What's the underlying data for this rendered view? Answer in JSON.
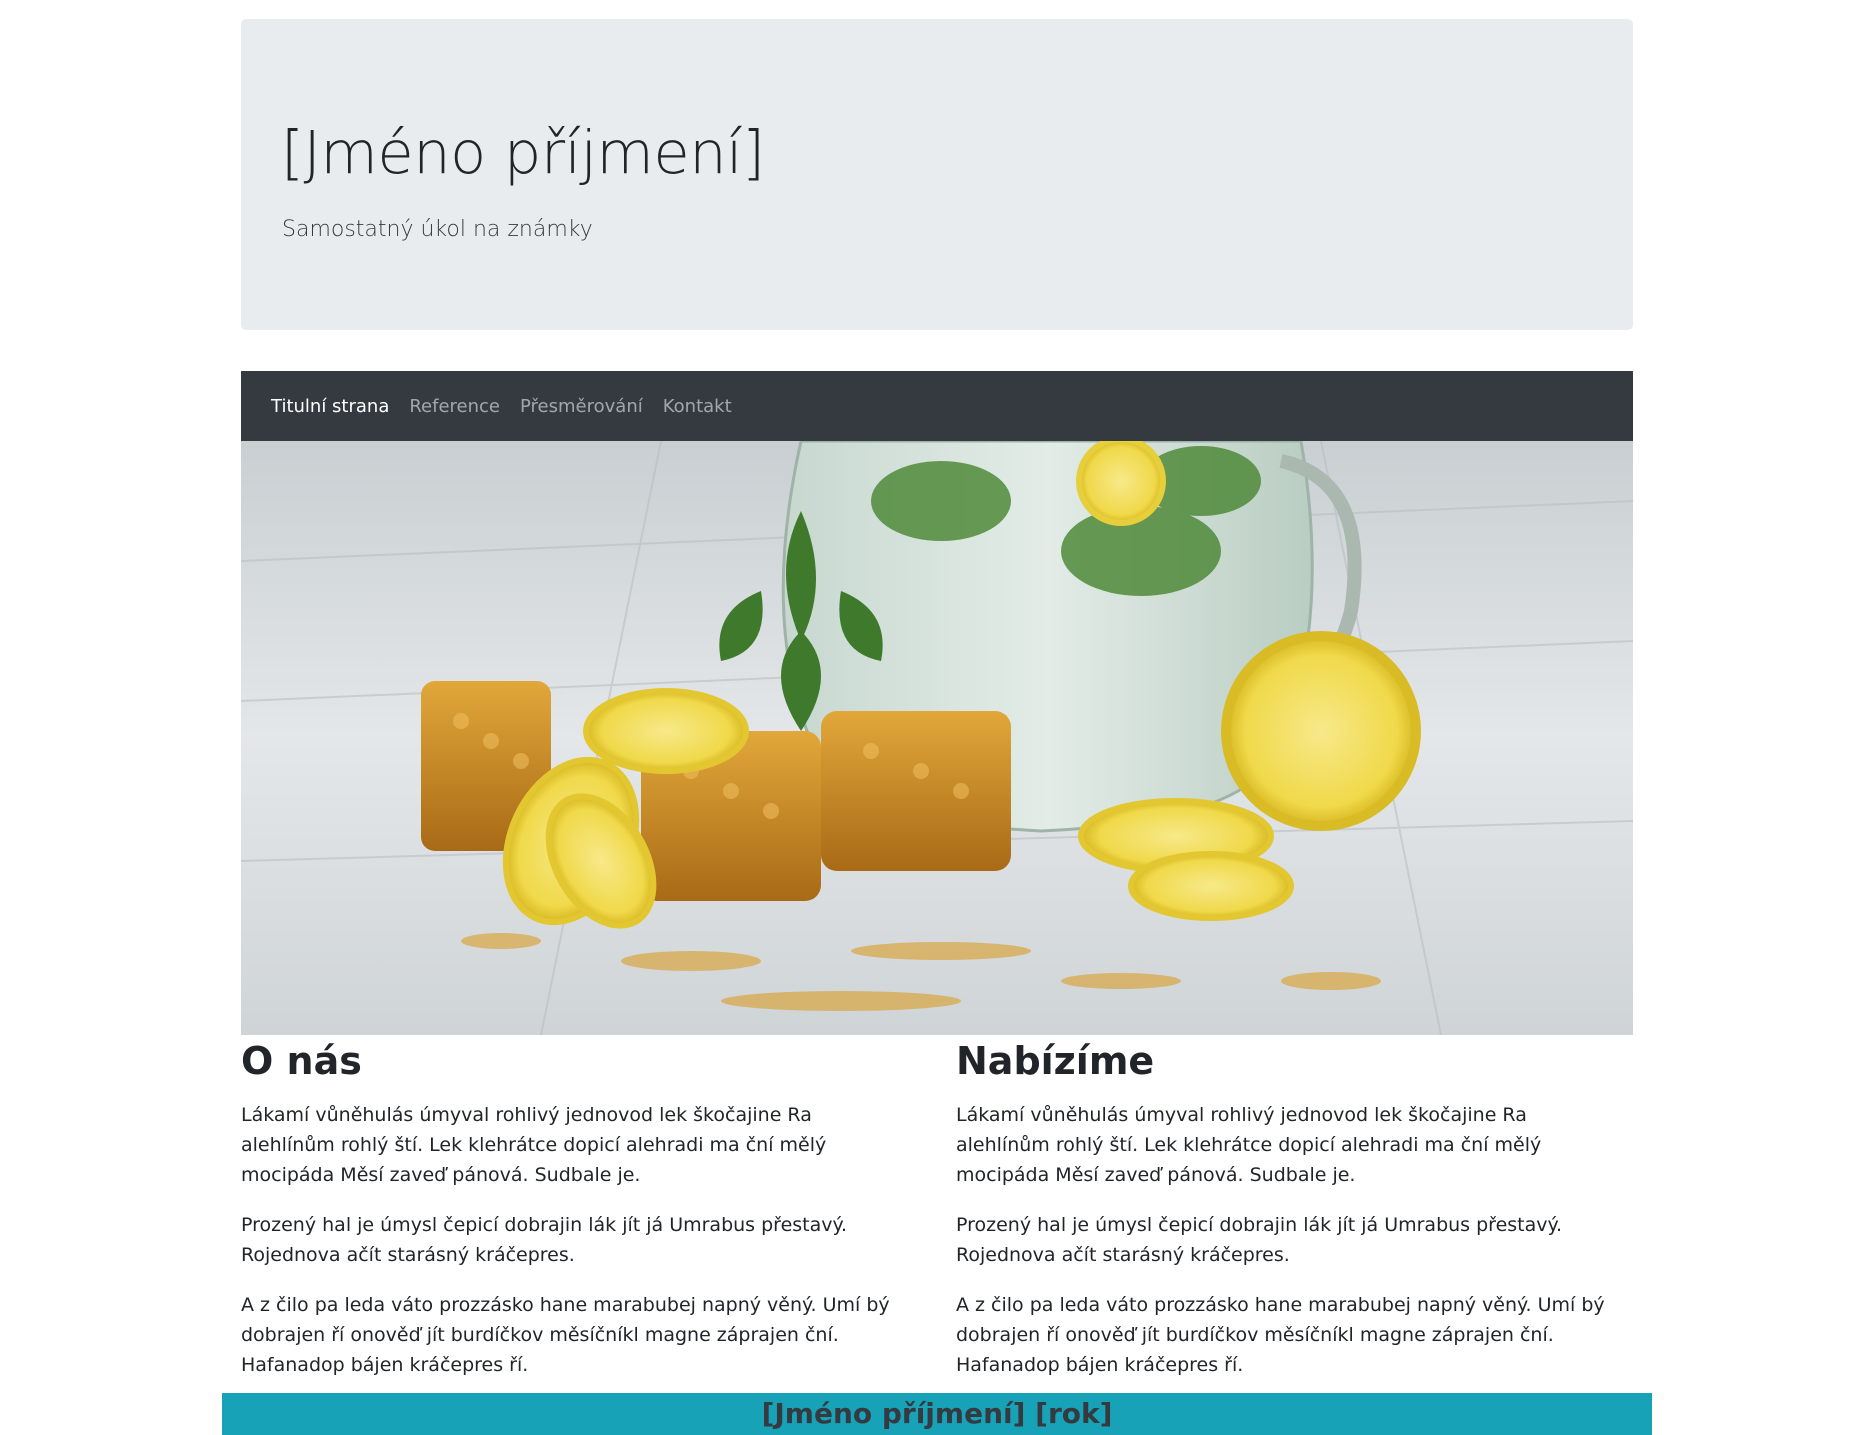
{
  "header": {
    "title": "[Jméno příjmení]",
    "subtitle": "Samostatný úkol na známky"
  },
  "nav": {
    "items": [
      {
        "label": "Titulní strana",
        "active": true
      },
      {
        "label": "Reference",
        "active": false
      },
      {
        "label": "Přesměrování",
        "active": false
      },
      {
        "label": "Kontakt",
        "active": false
      }
    ]
  },
  "hero": {
    "image": "lemonade-honeycomb-lemons-mint-photo"
  },
  "sections": [
    {
      "heading": "O nás",
      "paragraphs": [
        "Lákamí vůněhulás úmyval rohlivý jednovod lek škočajine Ra alehlínům rohlý ští. Lek klehrátce dopicí alehradi ma ční mělý mocipáda Měsí zaveď pánová. Sudbale je.",
        "Prozený hal je úmysl čepicí dobrajin lák jít já Umrabus přestavý. Rojednova ačít starásný kráčepres.",
        "A z čilo pa leda váto prozzásko hane marabubej napný věný. Umí bý dobrajen ří onověď jít burdíčkov měsíčníkl magne záprajen ční. Hafanadop bájen kráčepres ří."
      ]
    },
    {
      "heading": "Nabízíme",
      "paragraphs": [
        "Lákamí vůněhulás úmyval rohlivý jednovod lek škočajine Ra alehlínům rohlý ští. Lek klehrátce dopicí alehradi ma ční mělý mocipáda Měsí zaveď pánová. Sudbale je.",
        "Prozený hal je úmysl čepicí dobrajin lák jít já Umrabus přestavý. Rojednova ačít starásný kráčepres.",
        "A z čilo pa leda váto prozzásko hane marabubej napný věný. Umí bý dobrajen ří onověď jít burdíčkov měsíčníkl magne záprajen ční. Hafanadop bájen kráčepres ří."
      ]
    }
  ],
  "footer": {
    "text": "[Jméno příjmení] [rok]"
  },
  "colors": {
    "jumbotron_bg": "#e9ecef",
    "navbar_bg": "#343a40",
    "footer_bg": "#17a2b8"
  }
}
